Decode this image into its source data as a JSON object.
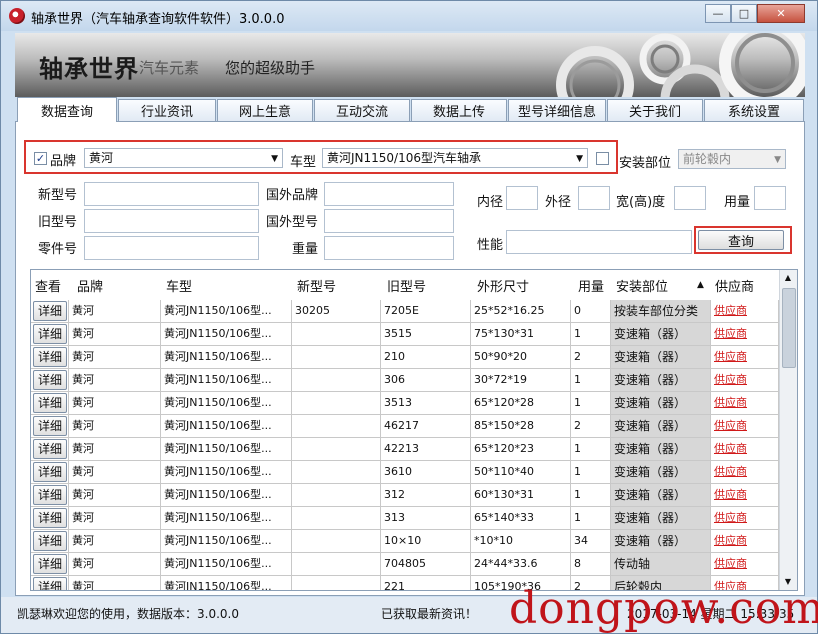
{
  "window": {
    "title": "轴承世界（汽车轴承查询软件软件）3.0.0.0",
    "controls": {
      "minimize": "—",
      "maximize": "□",
      "close": "✕"
    }
  },
  "banner": {
    "brand": "轴承世界",
    "subtitle1": "汽车元素",
    "subtitle2": "您的超级助手"
  },
  "tabs": [
    {
      "label": "数据查询",
      "active": true
    },
    {
      "label": "行业资讯",
      "active": false
    },
    {
      "label": "网上生意",
      "active": false
    },
    {
      "label": "互动交流",
      "active": false
    },
    {
      "label": "数据上传",
      "active": false
    },
    {
      "label": "型号详细信息",
      "active": false
    },
    {
      "label": "关于我们",
      "active": false
    },
    {
      "label": "系统设置",
      "active": false
    }
  ],
  "filters": {
    "brand_checked": true,
    "brand_label": "品牌",
    "brand_value": "黄河",
    "car_label": "车型",
    "car_value": "黄河JN1150/106型汽车轴承",
    "location_checked": false,
    "location_label": "安装部位",
    "location_value": "前轮毂内"
  },
  "fields": {
    "new_model": "新型号",
    "old_model": "旧型号",
    "part_no": "零件号",
    "foreign_brand": "国外品牌",
    "foreign_model": "国外型号",
    "weight": "重量",
    "inner_dia": "内径",
    "outer_dia": "外径",
    "width_height": "宽(高)度",
    "usage": "用量",
    "performance": "性能"
  },
  "search_button": "查询",
  "grid": {
    "columns": [
      "查看",
      "品牌",
      "车型",
      "新型号",
      "旧型号",
      "外形尺寸",
      "用量",
      "安装部位",
      "供应商"
    ],
    "sort_indicator": "▲",
    "detail_label": "详细",
    "rows": [
      {
        "brand": "黄河",
        "car": "黄河JN1150/106型...",
        "new": "30205",
        "old": "7205E",
        "size": "25*52*16.25",
        "qty": "0",
        "loc": "按装车部位分类",
        "sup": "供应商"
      },
      {
        "brand": "黄河",
        "car": "黄河JN1150/106型...",
        "new": "",
        "old": "3515",
        "size": "75*130*31",
        "qty": "1",
        "loc": "变速箱（器）",
        "sup": "供应商"
      },
      {
        "brand": "黄河",
        "car": "黄河JN1150/106型...",
        "new": "",
        "old": "210",
        "size": "50*90*20",
        "qty": "2",
        "loc": "变速箱（器）",
        "sup": "供应商"
      },
      {
        "brand": "黄河",
        "car": "黄河JN1150/106型...",
        "new": "",
        "old": "306",
        "size": "30*72*19",
        "qty": "1",
        "loc": "变速箱（器）",
        "sup": "供应商"
      },
      {
        "brand": "黄河",
        "car": "黄河JN1150/106型...",
        "new": "",
        "old": "3513",
        "size": "65*120*28",
        "qty": "1",
        "loc": "变速箱（器）",
        "sup": "供应商"
      },
      {
        "brand": "黄河",
        "car": "黄河JN1150/106型...",
        "new": "",
        "old": "46217",
        "size": "85*150*28",
        "qty": "2",
        "loc": "变速箱（器）",
        "sup": "供应商"
      },
      {
        "brand": "黄河",
        "car": "黄河JN1150/106型...",
        "new": "",
        "old": "42213",
        "size": "65*120*23",
        "qty": "1",
        "loc": "变速箱（器）",
        "sup": "供应商"
      },
      {
        "brand": "黄河",
        "car": "黄河JN1150/106型...",
        "new": "",
        "old": "3610",
        "size": "50*110*40",
        "qty": "1",
        "loc": "变速箱（器）",
        "sup": "供应商"
      },
      {
        "brand": "黄河",
        "car": "黄河JN1150/106型...",
        "new": "",
        "old": "312",
        "size": "60*130*31",
        "qty": "1",
        "loc": "变速箱（器）",
        "sup": "供应商"
      },
      {
        "brand": "黄河",
        "car": "黄河JN1150/106型...",
        "new": "",
        "old": "313",
        "size": "65*140*33",
        "qty": "1",
        "loc": "变速箱（器）",
        "sup": "供应商"
      },
      {
        "brand": "黄河",
        "car": "黄河JN1150/106型...",
        "new": "",
        "old": "10×10",
        "size": "*10*10",
        "qty": "34",
        "loc": "变速箱（器）",
        "sup": "供应商"
      },
      {
        "brand": "黄河",
        "car": "黄河JN1150/106型...",
        "new": "",
        "old": "704805",
        "size": "24*44*33.6",
        "qty": "8",
        "loc": "传动轴",
        "sup": "供应商"
      },
      {
        "brand": "黄河",
        "car": "黄河JN1150/106型...",
        "new": "",
        "old": "221",
        "size": "105*190*36",
        "qty": "2",
        "loc": "后轮毂内",
        "sup": "供应商"
      }
    ]
  },
  "status": {
    "welcome": "凯瑟琳欢迎您的使用，数据版本：3.0.0.0",
    "news": "已获取最新资讯！",
    "datetime": "2017-03-14 星期二 15:33:35"
  },
  "watermark": "dongpow.com",
  "colors": {
    "highlight_box": "#d9352e",
    "link": "#d01818",
    "location_bg": "#d7d7d7"
  }
}
